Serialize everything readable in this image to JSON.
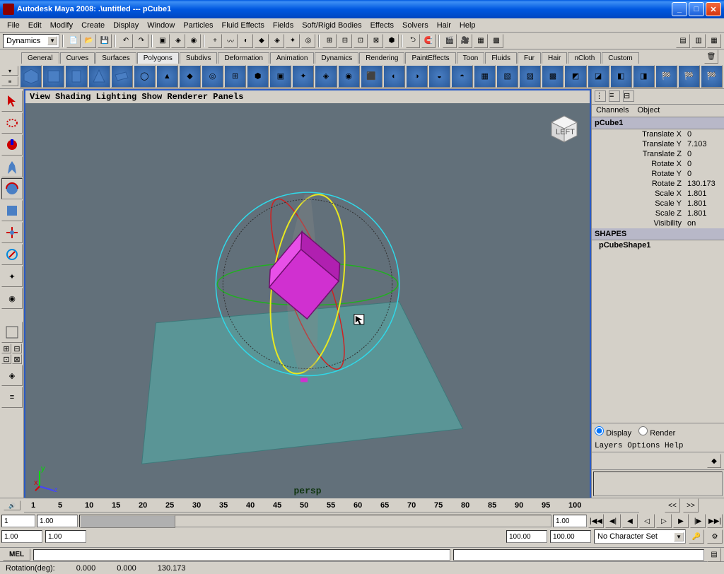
{
  "titlebar": {
    "text": "Autodesk Maya 2008: .\\untitled   ---   pCube1"
  },
  "menubar": [
    "File",
    "Edit",
    "Modify",
    "Create",
    "Display",
    "Window",
    "Particles",
    "Fluid Effects",
    "Fields",
    "Soft/Rigid Bodies",
    "Effects",
    "Solvers",
    "Hair",
    "Help"
  ],
  "module_dropdown": "Dynamics",
  "shelf_tabs": [
    "General",
    "Curves",
    "Surfaces",
    "Polygons",
    "Subdivs",
    "Deformation",
    "Animation",
    "Dynamics",
    "Rendering",
    "PaintEffects",
    "Toon",
    "Fluids",
    "Fur",
    "Hair",
    "nCloth",
    "Custom"
  ],
  "shelf_active": "Polygons",
  "viewport_menu": "View Shading Lighting Show Renderer Panels",
  "viewport_label": "persp",
  "viewcube_face": "LEFT",
  "panel_tabs": {
    "a": "Channels",
    "b": "Object"
  },
  "channel": {
    "object": "pCube1",
    "attrs": [
      {
        "label": "Translate X",
        "val": "0"
      },
      {
        "label": "Translate Y",
        "val": "7.103"
      },
      {
        "label": "Translate Z",
        "val": "0"
      },
      {
        "label": "Rotate X",
        "val": "0"
      },
      {
        "label": "Rotate Y",
        "val": "0"
      },
      {
        "label": "Rotate Z",
        "val": "130.173"
      },
      {
        "label": "Scale X",
        "val": "1.801"
      },
      {
        "label": "Scale Y",
        "val": "1.801"
      },
      {
        "label": "Scale Z",
        "val": "1.801"
      },
      {
        "label": "Visibility",
        "val": "on"
      }
    ],
    "shapes_header": "SHAPES",
    "shape_name": "pCubeShape1"
  },
  "layers": {
    "radio_display": "Display",
    "radio_render": "Render",
    "menu": "Layers Options Help"
  },
  "timeline": {
    "ticks": [
      "1",
      "5",
      "10",
      "15",
      "20",
      "25",
      "30",
      "35",
      "40",
      "45",
      "50",
      "55",
      "60",
      "65",
      "70",
      "75",
      "80",
      "85",
      "90",
      "95",
      "100"
    ],
    "nav_prev": "<<",
    "nav_next": ">>",
    "start": "1",
    "end": "100",
    "cur_a": "1.00",
    "cur_b": "1.00",
    "range_a": "100.00",
    "range_b": "100.00",
    "charset": "No Character Set"
  },
  "mel_label": "MEL",
  "status": {
    "label": "Rotation(deg):",
    "x": "0.000",
    "y": "0.000",
    "z": "130.173"
  }
}
